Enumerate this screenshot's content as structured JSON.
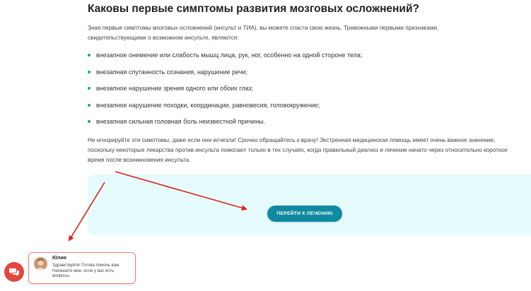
{
  "article": {
    "title": "Каковы первые симптомы развития мозговых осложнений?",
    "intro": "Зная первые симптомы мозговых осложнений (инсульт и ТИА), вы можете спасти свою жизнь. Тревожными первыми признаками, свидетельствующими о возможном инсульте, являются:",
    "symptoms": [
      "внезапное онемение или слабость мышц лица, рук, ног, особенно на одной стороне тела;",
      "внезапная спутанность сознания, нарушение речи;",
      "внезапное нарушение зрения одного или обоих глаз;",
      "внезапное нарушение походки, координации, равновесия, головокружение;",
      "внезапная сильная головная боль неизвестной причины."
    ],
    "warning": "Не игнорируйте эти симптомы, даже если они исчезли! Срочно обращайтесь к врачу! Экстренная медицинская помощь имеет очень важное значение, поскольку некоторые лекарства против инсульта помогают только в тех случаях, когда правильный диагноз и лечение начато через относительно короткое время после возникновения инсульта."
  },
  "cta": {
    "button_label": "ПЕРЕЙТИ К ЛЕЧЕНИЮ"
  },
  "chat": {
    "icon": "chat-bubbles-icon",
    "agent_name": "Юлия",
    "message": "Здравствуйте! Готова помочь вам. Напишите мне, если у вас есть вопросы."
  },
  "colors": {
    "accent": "#1e9bb0",
    "button": "#0f8aa0",
    "cta_bg": "#e6fbfb",
    "annotation_arrow": "#e0201b",
    "chat_fab": "#e2463f"
  }
}
